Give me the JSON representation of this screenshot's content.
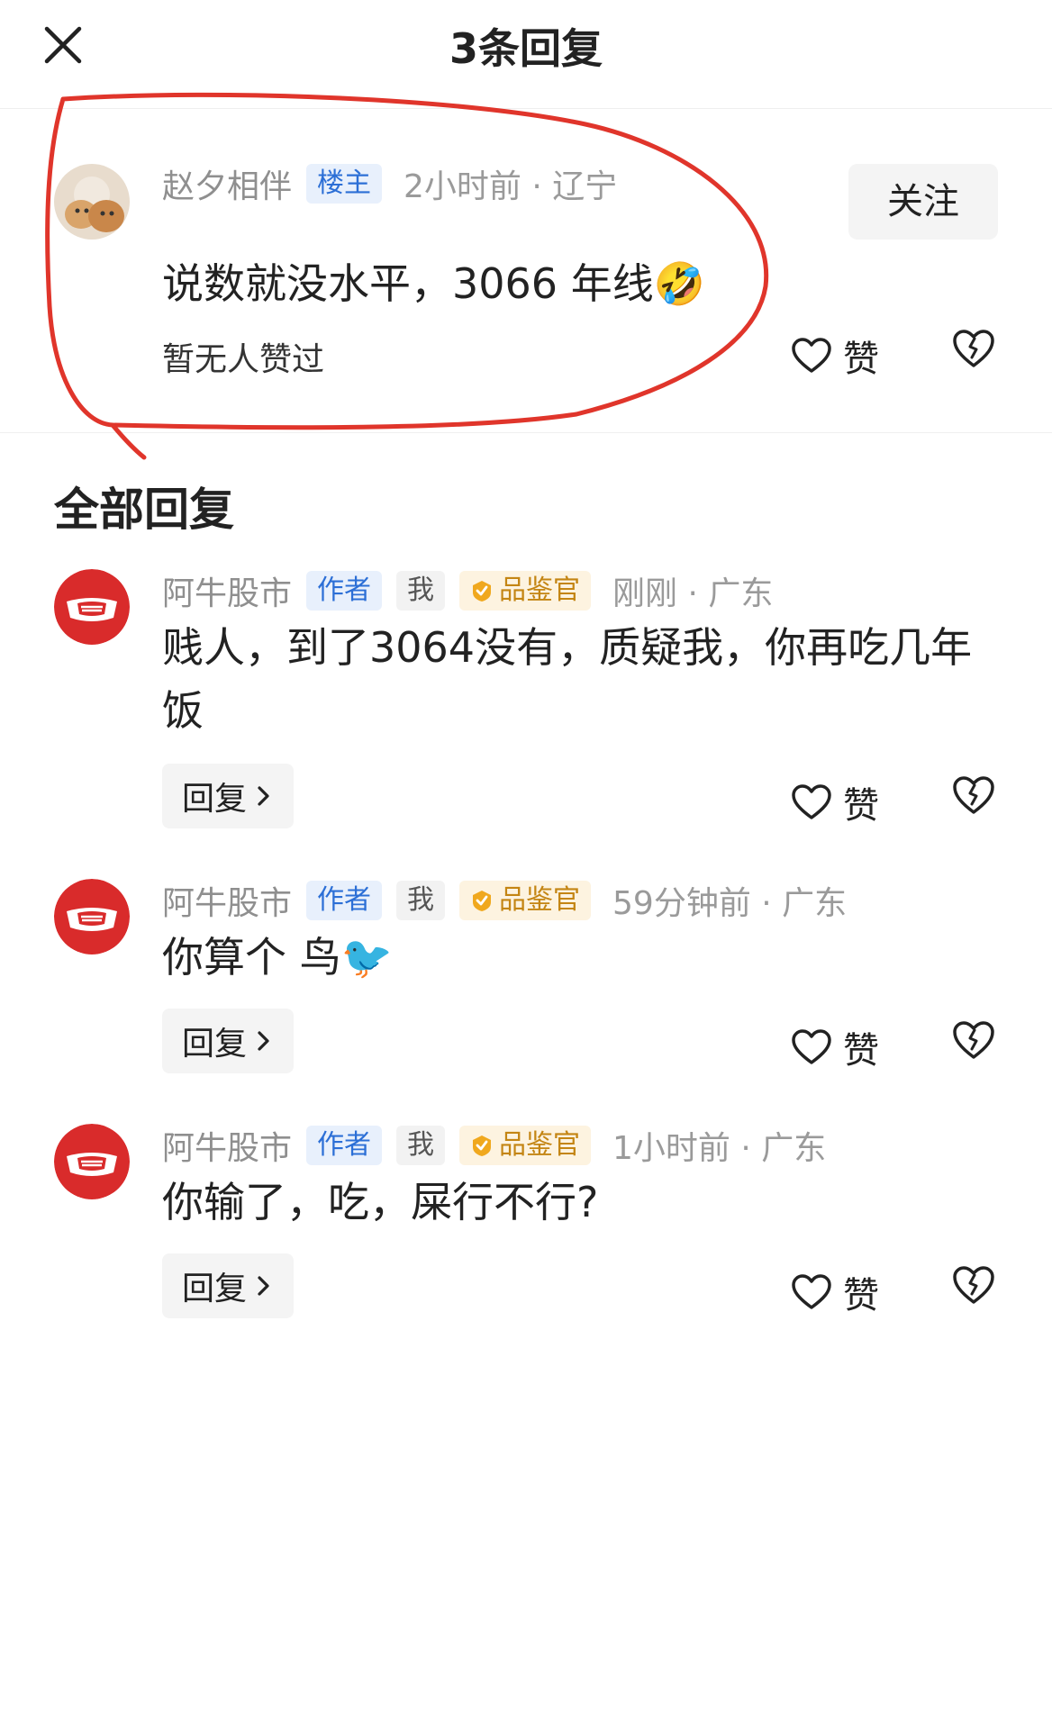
{
  "header": {
    "title": "3条回复"
  },
  "main_comment": {
    "username": "赵夕相伴",
    "badge": "楼主",
    "time_location": "2小时前 · 辽宁",
    "follow_label": "关注",
    "text": "说数就没水平，3066 年线🤣",
    "likes_status": "暂无人赞过",
    "like_label": "赞"
  },
  "section_title": "全部回复",
  "replies": [
    {
      "username": "阿牛股市",
      "tag_author": "作者",
      "tag_me": "我",
      "tag_critic": "品鉴官",
      "time_location": "刚刚 · 广东",
      "text": "贱人，到了3064没有，质疑我，你再吃几年饭",
      "reply_label": "回复",
      "like_label": "赞"
    },
    {
      "username": "阿牛股市",
      "tag_author": "作者",
      "tag_me": "我",
      "tag_critic": "品鉴官",
      "time_location": "59分钟前 · 广东",
      "text": "你算个 鸟🐦",
      "reply_label": "回复",
      "like_label": "赞"
    },
    {
      "username": "阿牛股市",
      "tag_author": "作者",
      "tag_me": "我",
      "tag_critic": "品鉴官",
      "time_location": "1小时前 · 广东",
      "text": "你输了，吃，屎行不行?",
      "reply_label": "回复",
      "like_label": "赞"
    }
  ],
  "icons": {
    "close": "close-icon",
    "like": "heart-icon",
    "dislike": "broken-heart-icon",
    "reply_arrow": "chevron-right-icon",
    "critic_badge": "check-badge-icon"
  },
  "colors": {
    "annotation": "#e0352b",
    "avatar_red": "#d92b2b",
    "tag_blue": "#2c6fd6",
    "tag_gold": "#c48513"
  }
}
